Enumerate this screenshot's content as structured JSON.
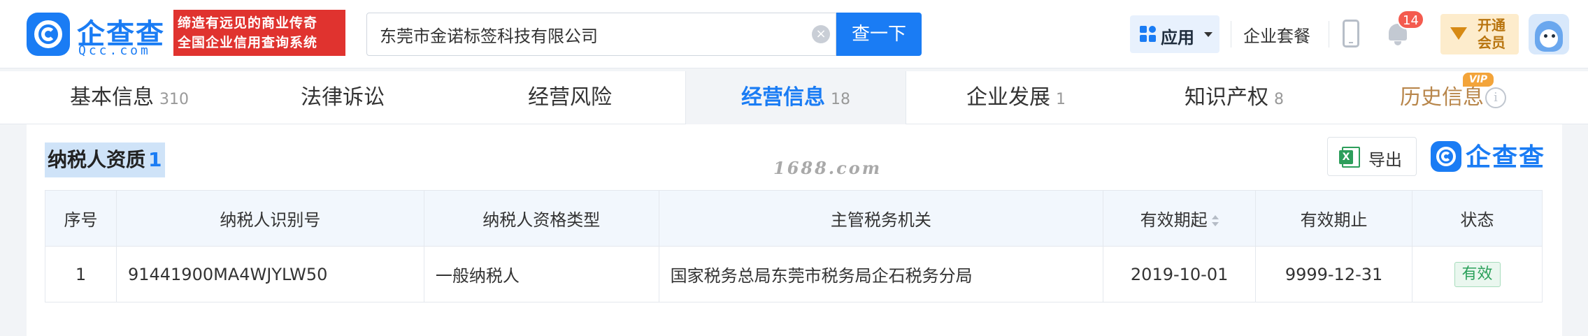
{
  "header": {
    "logo_cn": "企查查",
    "logo_en": "Qcc.com",
    "slogan_line1": "缔造有远见的商业传奇",
    "slogan_line2": "全国企业信用查询系统",
    "search_value": "东莞市金诺标签科技有限公司",
    "search_button": "查一下",
    "app_label": "应用",
    "package_link": "企业套餐",
    "notification_count": "14",
    "vip_line1": "开通",
    "vip_line2": "会员"
  },
  "tabs": [
    {
      "label": "基本信息",
      "count": "310"
    },
    {
      "label": "法律诉讼",
      "count": ""
    },
    {
      "label": "经营风险",
      "count": ""
    },
    {
      "label": "经营信息",
      "count": "18"
    },
    {
      "label": "企业发展",
      "count": "1"
    },
    {
      "label": "知识产权",
      "count": "8"
    },
    {
      "label": "历史信息",
      "count": "",
      "tag": "VIP"
    }
  ],
  "section": {
    "title": "纳税人资质",
    "count": "1",
    "watermark": "1688.com",
    "export_label": "导出",
    "brand": "企查查"
  },
  "table": {
    "headers": [
      "序号",
      "纳税人识别号",
      "纳税人资格类型",
      "主管税务机关",
      "有效期起",
      "有效期止",
      "状态"
    ],
    "rows": [
      [
        "1",
        "91441900MA4WJYLW50",
        "一般纳税人",
        "国家税务总局东莞市税务局企石税务分局",
        "2019-10-01",
        "9999-12-31",
        "有效"
      ]
    ]
  },
  "icons": [
    "search-clear-icon",
    "apps-grid-icon",
    "chevron-down-icon",
    "phone-icon",
    "bell-icon",
    "vip-gem-icon",
    "avatar",
    "info-icon",
    "excel-icon",
    "sort-icon"
  ],
  "colors": {
    "brand": "#1a7cf4",
    "slogan_bg": "#e0332f",
    "status_green": "#2aa05a",
    "vip_gold": "#b8740e"
  }
}
